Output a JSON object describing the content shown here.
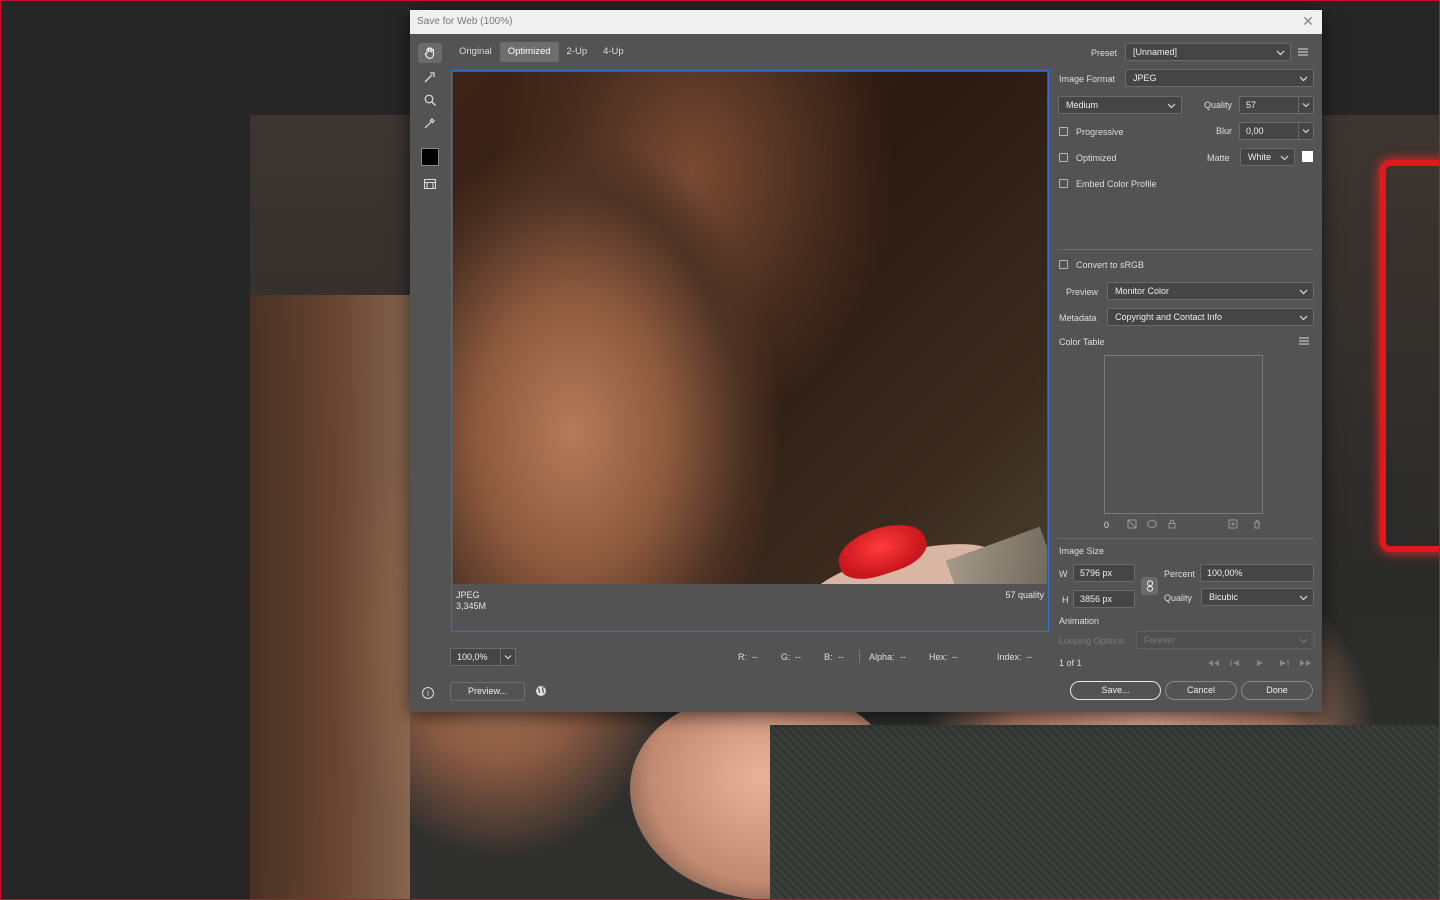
{
  "dialog": {
    "title": "Save for Web (100%)",
    "tabs": [
      {
        "label": "Original"
      },
      {
        "label": "Optimized"
      },
      {
        "label": "2-Up"
      },
      {
        "label": "4-Up"
      }
    ],
    "active_tab": "Optimized"
  },
  "preview": {
    "format": "JPEG",
    "size": "3,345M",
    "quality_note": "57 quality"
  },
  "bottom": {
    "zoom": "100,0%",
    "r": "R:",
    "r_val": "--",
    "g": "G:",
    "g_val": "--",
    "b": "B:",
    "b_val": "--",
    "alpha": "Alpha:",
    "alpha_val": "--",
    "hex": "Hex:",
    "hex_val": "--",
    "index": "Index:",
    "index_val": "--",
    "preview_btn": "Preview...",
    "save_btn": "Save...",
    "cancel_btn": "Cancel",
    "done_btn": "Done"
  },
  "settings": {
    "preset_label": "Preset",
    "preset_value": "[Unnamed]",
    "format_label": "Image Format",
    "format_value": "JPEG",
    "quality_level": "Medium",
    "quality_label": "Quality",
    "quality_value": "57",
    "progressive": "Progressive",
    "blur_label": "Blur",
    "blur_value": "0,00",
    "optimized": "Optimized",
    "matte_label": "Matte",
    "matte_value": "White",
    "embed_profile": "Embed Color Profile",
    "convert_srgb": "Convert to sRGB",
    "preview_label": "Preview",
    "preview_value": "Monitor Color",
    "metadata_label": "Metadata",
    "metadata_value": "Copyright and Contact Info",
    "color_table_label": "Color Table",
    "color_count": "0"
  },
  "image_size": {
    "heading": "Image Size",
    "w_label": "W",
    "w_value": "5796 px",
    "h_label": "H",
    "h_value": "3856 px",
    "percent_label": "Percent",
    "percent_value": "100,00%",
    "quality_label": "Quality",
    "quality_value": "Bicubic"
  },
  "animation": {
    "heading": "Animation",
    "looping_label": "Looping Options",
    "looping_value": "Forever",
    "frame_counter": "1 of 1"
  },
  "colors": {
    "accent_border": "#2e6fd8",
    "dialog_bg": "#535353",
    "matte_swatch": "#ffffff",
    "foreground_swatch": "#000000",
    "frame": "#c8102e"
  }
}
